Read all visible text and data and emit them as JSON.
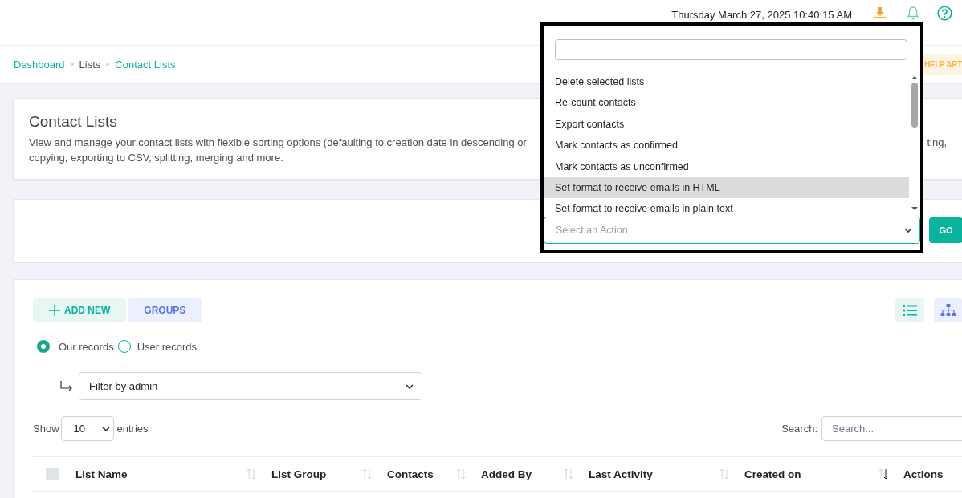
{
  "header": {
    "datetime": "Thursday March 27, 2025 10:40:15 AM"
  },
  "breadcrumb": [
    {
      "label": "Dashboard",
      "link": true
    },
    {
      "label": "Lists",
      "link": false
    },
    {
      "label": "Contact Lists",
      "link": true
    }
  ],
  "help_button": "HELP ART",
  "intro": {
    "title": "Contact Lists",
    "description_line_1_start": "View and manage your contact lists with flexible sorting options (defaulting to creation date in descending or",
    "description_line_1_end": "ting,",
    "description_line_2": "copying, exporting to CSV, splitting, merging and more."
  },
  "action_bar": {
    "go_button": "GO"
  },
  "action_dropdown": {
    "options": [
      {
        "label": "Delete selected lists",
        "selected": false
      },
      {
        "label": "Re-count contacts",
        "selected": false
      },
      {
        "label": "Export contacts",
        "selected": false
      },
      {
        "label": "Mark contacts as confirmed",
        "selected": false
      },
      {
        "label": "Mark contacts as unconfirmed",
        "selected": false
      },
      {
        "label": "Set format to receive emails in HTML",
        "selected": true
      },
      {
        "label": "Set format to receive emails in plain text",
        "selected": false
      }
    ],
    "select_placeholder": "Select an Action"
  },
  "toolbar": {
    "buttons": [
      {
        "label": "ADD NEW",
        "kind": "add"
      },
      {
        "label": "GROUPS",
        "kind": "plain"
      }
    ],
    "views": [
      {
        "kind": "list"
      },
      {
        "kind": "tree"
      }
    ]
  },
  "record_filter": [
    {
      "label": "Our records",
      "selected": true
    },
    {
      "label": "User records",
      "selected": false
    }
  ],
  "admin_filter": {
    "value": "Filter by admin"
  },
  "entries": {
    "show_label": "Show",
    "value": "10",
    "suffix": "entries"
  },
  "search": {
    "label": "Search:",
    "placeholder": "Search..."
  },
  "table": {
    "select_all_checked": false,
    "columns": [
      {
        "label": "List Name",
        "sorted_desc": false
      },
      {
        "label": "List Group",
        "sorted_desc": false
      },
      {
        "label": "Contacts",
        "sorted_desc": false
      },
      {
        "label": "Added By",
        "sorted_desc": false
      },
      {
        "label": "Last Activity",
        "sorted_desc": false
      },
      {
        "label": "Created on",
        "sorted_desc": true
      },
      {
        "label": "Actions"
      }
    ]
  }
}
